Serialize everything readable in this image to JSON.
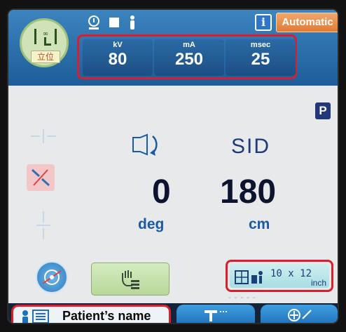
{
  "position": {
    "label": "立位",
    "icon": "standing-position-icon"
  },
  "status_icons": [
    "tube-icon",
    "square-icon",
    "person-icon"
  ],
  "info_icon_label": "i",
  "mode_button": "Automatic",
  "exposure": [
    {
      "unit": "kV",
      "value": "80"
    },
    {
      "unit": "mA",
      "value": "250"
    },
    {
      "unit": "msec",
      "value": "25"
    }
  ],
  "program_badge": "P",
  "rotation": {
    "value": "0",
    "unit": "deg",
    "icon": "rotation-icon"
  },
  "sid": {
    "label": "SID",
    "value": "180",
    "unit": "cm"
  },
  "cassette": {
    "size_text": "10 x 12",
    "unit": "inch",
    "icon": "cassette-orientation-icon"
  },
  "tabs": [
    {
      "label": "Patient’s name",
      "icon": "patient-card-icon",
      "active": true
    },
    {
      "label": "",
      "icon": "table-height-icon",
      "active": false
    },
    {
      "label": "",
      "icon": "tube-settings-icon",
      "active": false
    }
  ],
  "colors": {
    "highlight": "#d91f2c",
    "accent_blue": "#1f6fb9",
    "auto_orange": "#e07b35"
  }
}
